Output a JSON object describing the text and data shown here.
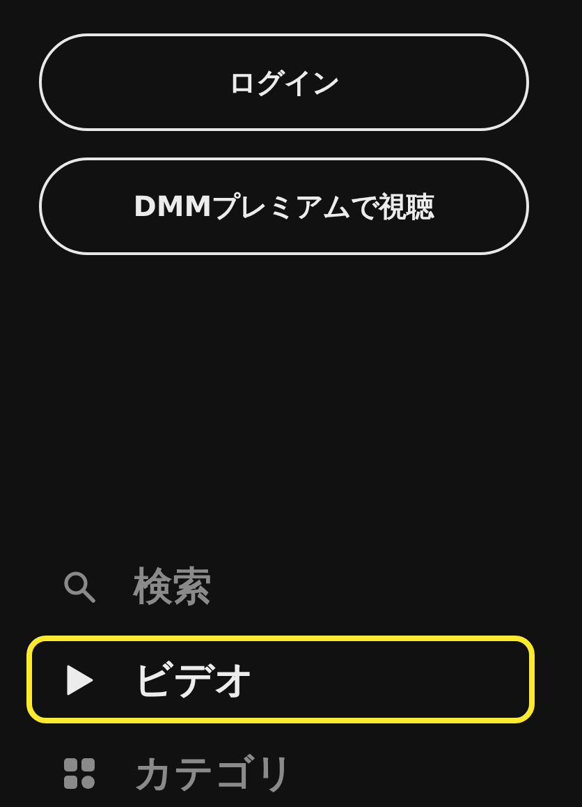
{
  "buttons": [
    {
      "label": "ログイン"
    },
    {
      "label": "DMMプレミアムで視聴"
    }
  ],
  "nav": {
    "items": [
      {
        "kind": "search",
        "label": "検索",
        "selected": false
      },
      {
        "kind": "play",
        "label": "ビデオ",
        "selected": true
      },
      {
        "kind": "grid",
        "label": "カテゴリ",
        "selected": false
      }
    ]
  }
}
